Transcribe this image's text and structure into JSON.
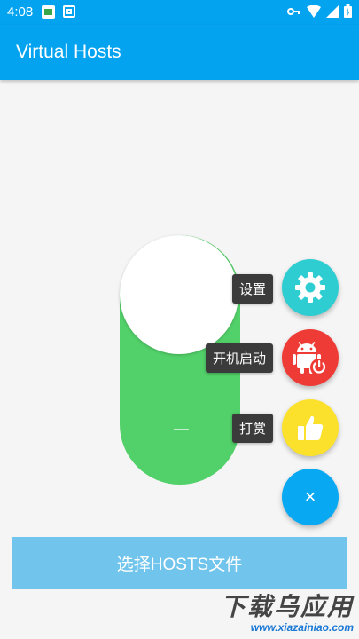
{
  "status_bar": {
    "time": "4:08",
    "icons": [
      "notification-app-icon",
      "notification-square-icon",
      "vpn-key-icon",
      "wifi-icon",
      "signal-icon",
      "battery-icon"
    ]
  },
  "app_bar": {
    "title": "Virtual Hosts"
  },
  "switch": {
    "state": "on",
    "knob_label": "—",
    "color": "#52d069"
  },
  "fab_menu": {
    "settings": {
      "label": "设置",
      "icon": "gear-icon",
      "color": "#2ecdd1"
    },
    "autostart": {
      "label": "开机启动",
      "icon": "android-power-icon",
      "color": "#ef3b36"
    },
    "reward": {
      "label": "打赏",
      "icon": "thumbs-up-icon",
      "color": "#fbe12c"
    },
    "close": {
      "glyph": "×",
      "icon": "close-icon",
      "color": "#08a9f2"
    }
  },
  "select_button": {
    "label": "选择HOSTS文件"
  },
  "watermark": {
    "title": "下载乌应用",
    "url": "www.xiazainiao.com"
  },
  "colors": {
    "primary": "#03a3f0",
    "button": "#71c4ec"
  }
}
